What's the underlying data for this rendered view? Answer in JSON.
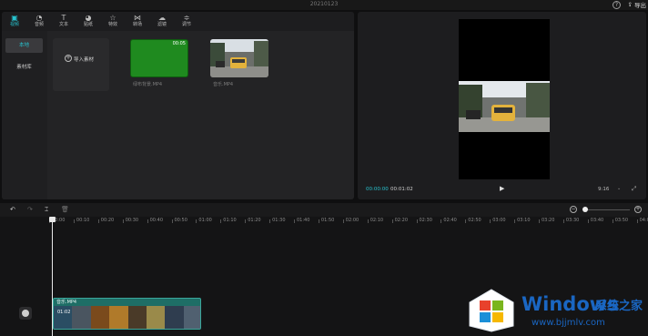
{
  "app": {
    "window_title": "20210123",
    "export_label": "导出"
  },
  "toolbar": {
    "items": [
      {
        "label": "视频",
        "icon": "video-icon"
      },
      {
        "label": "音频",
        "icon": "audio-icon"
      },
      {
        "label": "文本",
        "icon": "text-icon"
      },
      {
        "label": "贴纸",
        "icon": "sticker-icon"
      },
      {
        "label": "特效",
        "icon": "effects-icon"
      },
      {
        "label": "转场",
        "icon": "transition-icon"
      },
      {
        "label": "滤镜",
        "icon": "filter-icon"
      },
      {
        "label": "调节",
        "icon": "adjust-icon"
      }
    ]
  },
  "sidebar": {
    "items": [
      {
        "label": "本地"
      },
      {
        "label": "素材库"
      }
    ]
  },
  "media": {
    "import_label": "导入素材",
    "clips": [
      {
        "name": "绿布背景.MP4",
        "duration": "00:05"
      },
      {
        "name": "音乐.MP4",
        "duration": ""
      }
    ]
  },
  "preview": {
    "current_time": "00:00:00",
    "total_time": "00:01:02",
    "aspect_ratio": "9:16"
  },
  "ruler": {
    "ticks": [
      "00:00",
      "00:10",
      "00:20",
      "00:30",
      "00:40",
      "00:50",
      "01:00",
      "01:10",
      "01:20",
      "01:30",
      "01:40",
      "01:50",
      "02:00",
      "02:10",
      "02:20",
      "02:30",
      "02:40",
      "02:50",
      "03:00",
      "03:10",
      "03:20",
      "03:30",
      "03:40",
      "03:50",
      "04:00"
    ]
  },
  "track": {
    "clip_name": "音乐.MP4",
    "clip_duration": "01:02"
  },
  "watermark": {
    "title": "Windows",
    "subtitle": "系统之家",
    "url": "www.bjjmlv.com"
  },
  "colors": {
    "accent": "#27c3cf",
    "clip_track": "#1e6e66",
    "watermark_blue": "#1a66c2"
  }
}
